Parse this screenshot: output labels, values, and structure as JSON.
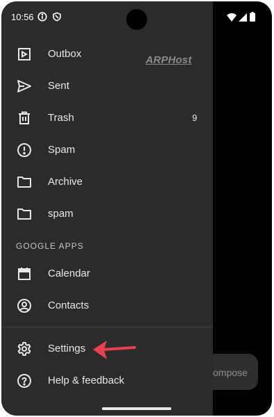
{
  "status_bar": {
    "time": "10:56",
    "left_icons": [
      "info-icon",
      "shield-icon"
    ],
    "right_icons": [
      "wifi-icon",
      "signal-icon",
      "battery-icon"
    ]
  },
  "watermark": "ARPHost",
  "drawer": {
    "items": [
      {
        "label": "Outbox",
        "icon": "outbox-icon"
      },
      {
        "label": "Sent",
        "icon": "send-icon"
      },
      {
        "label": "Trash",
        "icon": "trash-icon",
        "count": "9"
      },
      {
        "label": "Spam",
        "icon": "spam-icon"
      },
      {
        "label": "Archive",
        "icon": "folder-icon"
      },
      {
        "label": "spam",
        "icon": "folder-icon"
      }
    ],
    "section_header": "GOOGLE APPS",
    "apps": [
      {
        "label": "Calendar",
        "icon": "calendar-icon"
      },
      {
        "label": "Contacts",
        "icon": "contacts-icon"
      }
    ],
    "bottom": [
      {
        "label": "Settings",
        "icon": "gear-icon"
      },
      {
        "label": "Help & feedback",
        "icon": "help-icon"
      }
    ]
  },
  "compose": {
    "label": "ompose"
  },
  "colors": {
    "drawer_bg": "#2b2b2b",
    "text": "#e8e8e8",
    "annotation_arrow": "#e8424f"
  }
}
